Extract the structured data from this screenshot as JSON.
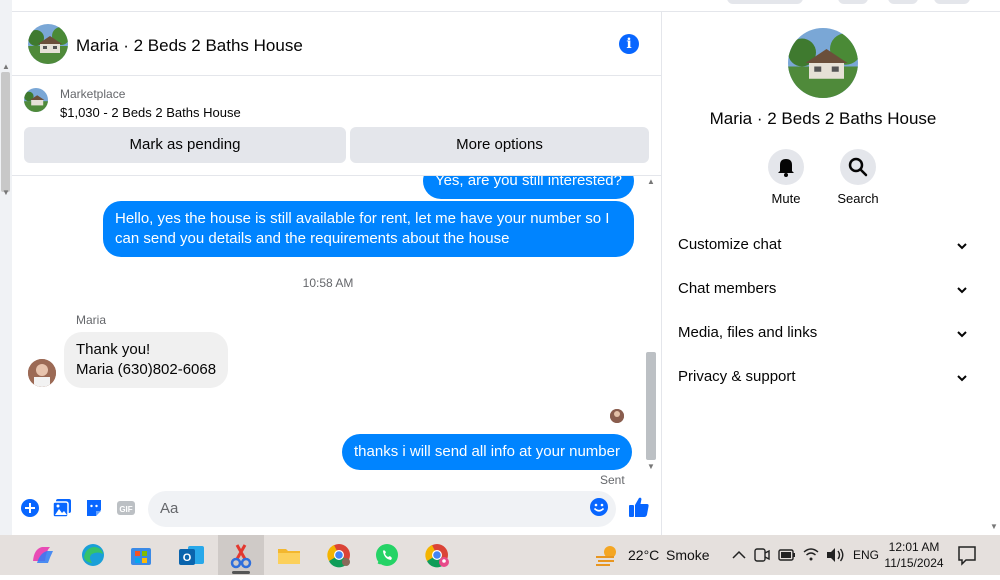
{
  "conversation": {
    "title": "Maria · 2 Beds 2 Baths House"
  },
  "listing": {
    "source": "Marketplace",
    "price_title": "$1,030 - 2 Beds 2 Baths House",
    "mark_pending_label": "Mark as pending",
    "more_options_label": "More options"
  },
  "messages": {
    "partial_outgoing": "Yes, are you still interested?",
    "outgoing_1": "Hello, yes the house is still available for rent, let me have your number so I can send you details and the requirements about the house",
    "timestamp": "10:58 AM",
    "incoming_sender": "Maria",
    "incoming_line1": "Thank you!",
    "incoming_line2": "Maria (630)802-6068",
    "outgoing_2": "thanks i will send all info at your number",
    "status": "Sent"
  },
  "composer": {
    "placeholder": "Aa"
  },
  "panel": {
    "title": "Maria · 2 Beds 2 Baths House",
    "mute_label": "Mute",
    "search_label": "Search",
    "sections": [
      "Customize chat",
      "Chat members",
      "Media, files and links",
      "Privacy & support"
    ]
  },
  "taskbar": {
    "weather_temp": "22°C",
    "weather_desc": "Smoke",
    "language": "ENG",
    "time": "12:01 AM",
    "date": "11/15/2024"
  },
  "colors": {
    "accent": "#0866ff",
    "outgoing_bubble": "#0084ff",
    "incoming_bubble": "#f0f0f0"
  }
}
